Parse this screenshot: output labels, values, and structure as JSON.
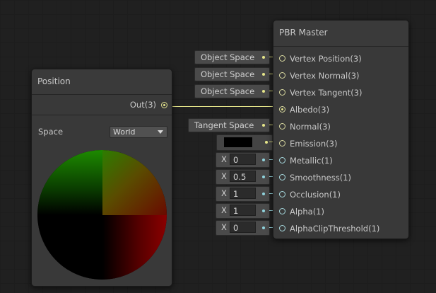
{
  "position_node": {
    "title": "Position",
    "output_label": "Out(3)",
    "space_label": "Space",
    "space_value": "World"
  },
  "pbr_master": {
    "title": "PBR Master",
    "ports": [
      {
        "label": "Vertex Position(3)"
      },
      {
        "label": "Vertex Normal(3)"
      },
      {
        "label": "Vertex Tangent(3)"
      },
      {
        "label": "Albedo(3)"
      },
      {
        "label": "Normal(3)"
      },
      {
        "label": "Emission(3)"
      },
      {
        "label": "Metallic(1)"
      },
      {
        "label": "Smoothness(1)"
      },
      {
        "label": "Occlusion(1)"
      },
      {
        "label": "Alpha(1)"
      },
      {
        "label": "AlphaClipThreshold(1)"
      }
    ]
  },
  "inputs": {
    "vertex_position_space": "Object Space",
    "vertex_normal_space": "Object Space",
    "vertex_tangent_space": "Object Space",
    "normal_space": "Tangent Space",
    "emission_color": "#000000",
    "axis_label": "X",
    "metallic": "0",
    "smoothness": "0.5",
    "occlusion": "1",
    "alpha": "1",
    "alpha_clip": "0"
  },
  "colors": {
    "vector3_port": "#e6e68a",
    "vector1_port": "#8fd3dc",
    "background": "#202020",
    "node_body": "#393939"
  }
}
